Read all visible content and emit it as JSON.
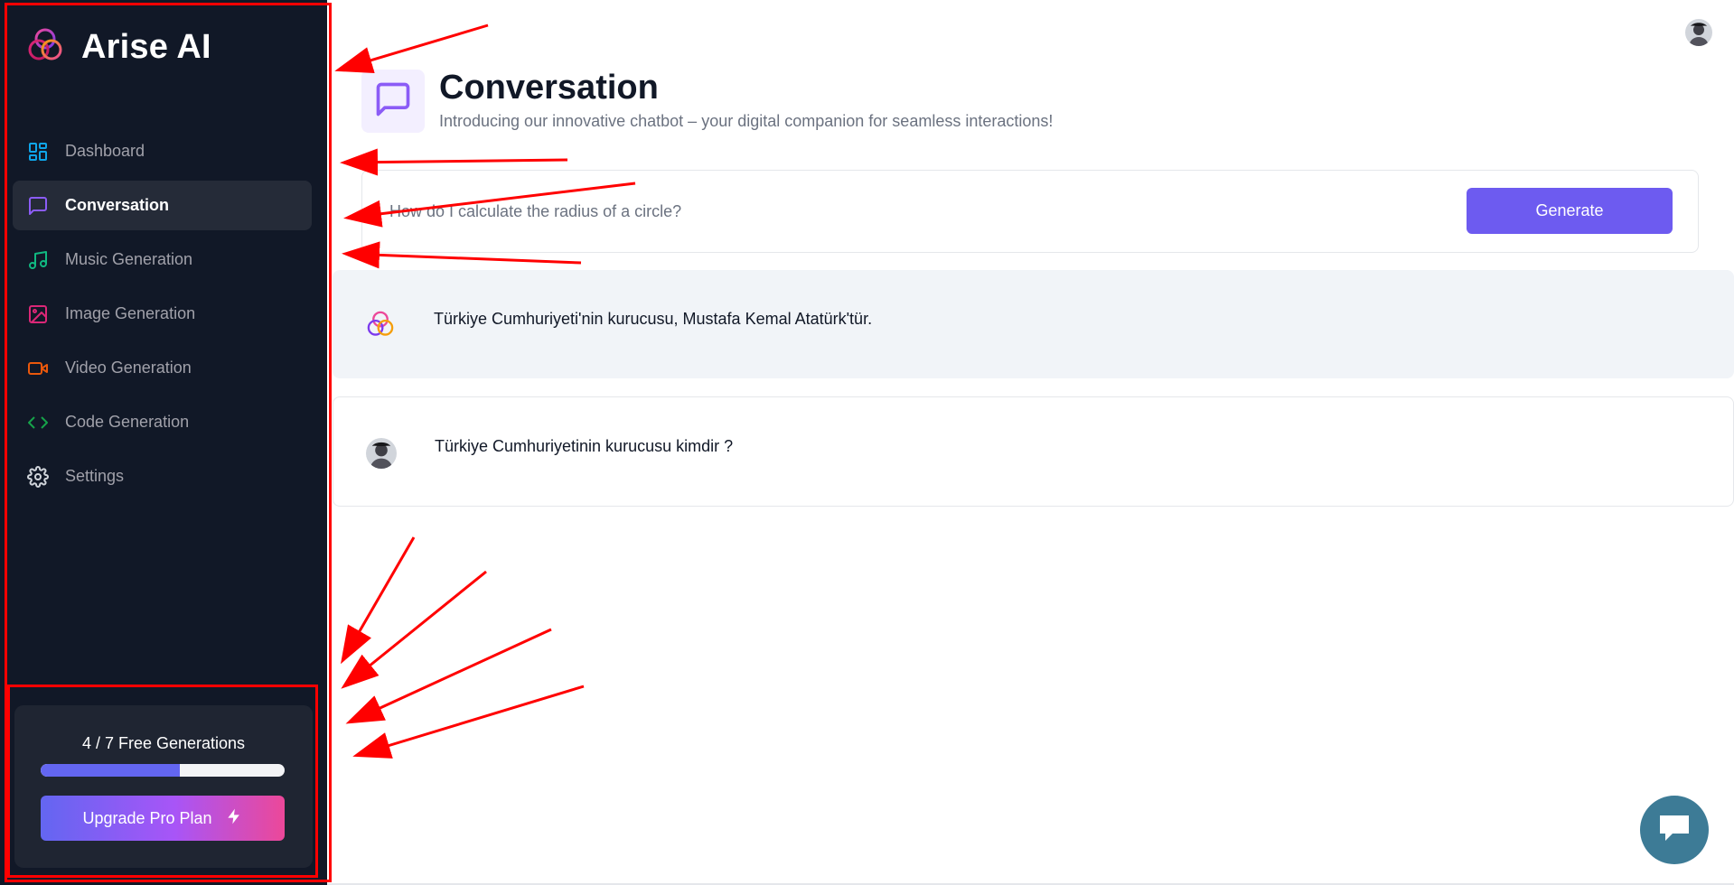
{
  "app": {
    "name": "Arise AI",
    "colors": {
      "sidebar_bg": "#111827",
      "accent": "#6d5bf0",
      "annotation": "#ff0000"
    }
  },
  "sidebar": {
    "items": [
      {
        "label": "Dashboard",
        "icon": "dashboard-icon",
        "color": "#0ea5e9",
        "active": false
      },
      {
        "label": "Conversation",
        "icon": "chat-icon",
        "color": "#8b5cf6",
        "active": true
      },
      {
        "label": "Music Generation",
        "icon": "music-icon",
        "color": "#10b981",
        "active": false
      },
      {
        "label": "Image Generation",
        "icon": "image-icon",
        "color": "#db2777",
        "active": false
      },
      {
        "label": "Video Generation",
        "icon": "video-icon",
        "color": "#ea580c",
        "active": false
      },
      {
        "label": "Code Generation",
        "icon": "code-icon",
        "color": "#16a34a",
        "active": false
      },
      {
        "label": "Settings",
        "icon": "gear-icon",
        "color": "#d1d5db",
        "active": false
      }
    ],
    "usage": {
      "text": "4 / 7 Free Generations",
      "progress": 0.57
    },
    "upgrade_label": "Upgrade Pro Plan"
  },
  "header": {
    "title": "Conversation",
    "subtitle": "Introducing our innovative chatbot – your digital companion for seamless interactions!"
  },
  "prompt": {
    "placeholder": "How do I calculate the radius of a circle?",
    "value": "",
    "generate_label": "Generate"
  },
  "messages": [
    {
      "role": "assistant",
      "text": "Türkiye Cumhuriyeti'nin kurucusu, Mustafa Kemal Atatürk'tür."
    },
    {
      "role": "user",
      "text": "Türkiye Cumhuriyetinin kurucusu kimdir ?"
    }
  ]
}
